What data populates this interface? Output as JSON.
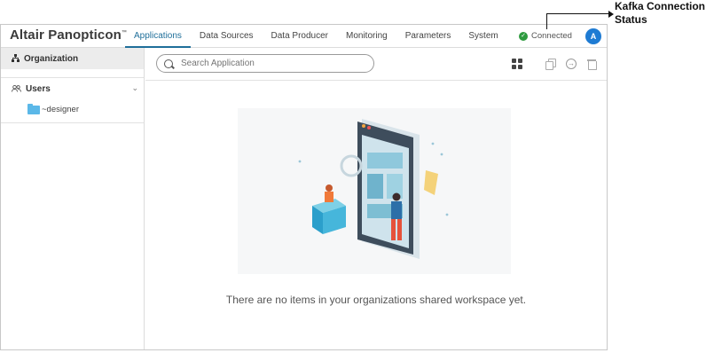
{
  "app": {
    "brand": "Altair Panopticon",
    "brand_mark": "™"
  },
  "nav": {
    "tabs": [
      {
        "label": "Applications",
        "active": true
      },
      {
        "label": "Data Sources",
        "active": false
      },
      {
        "label": "Data Producer",
        "active": false
      },
      {
        "label": "Monitoring",
        "active": false
      },
      {
        "label": "Parameters",
        "active": false
      },
      {
        "label": "System",
        "active": false
      }
    ]
  },
  "status": {
    "label": "Connected",
    "icon": "check-circle-icon",
    "color": "#2e9b3f"
  },
  "user": {
    "avatar_initial": "A",
    "avatar_color": "#1e7bd3"
  },
  "sidebar": {
    "organization_label": "Organization",
    "users_label": "Users",
    "folder_label": "~designer"
  },
  "main": {
    "search_placeholder": "Search Application",
    "empty_message": "There are no items in your organizations shared workspace yet."
  },
  "annotation": {
    "line1": "Kafka Connection",
    "line2": "Status"
  },
  "colors": {
    "accent": "#1f6f9a",
    "folder": "#5bb8e8"
  }
}
